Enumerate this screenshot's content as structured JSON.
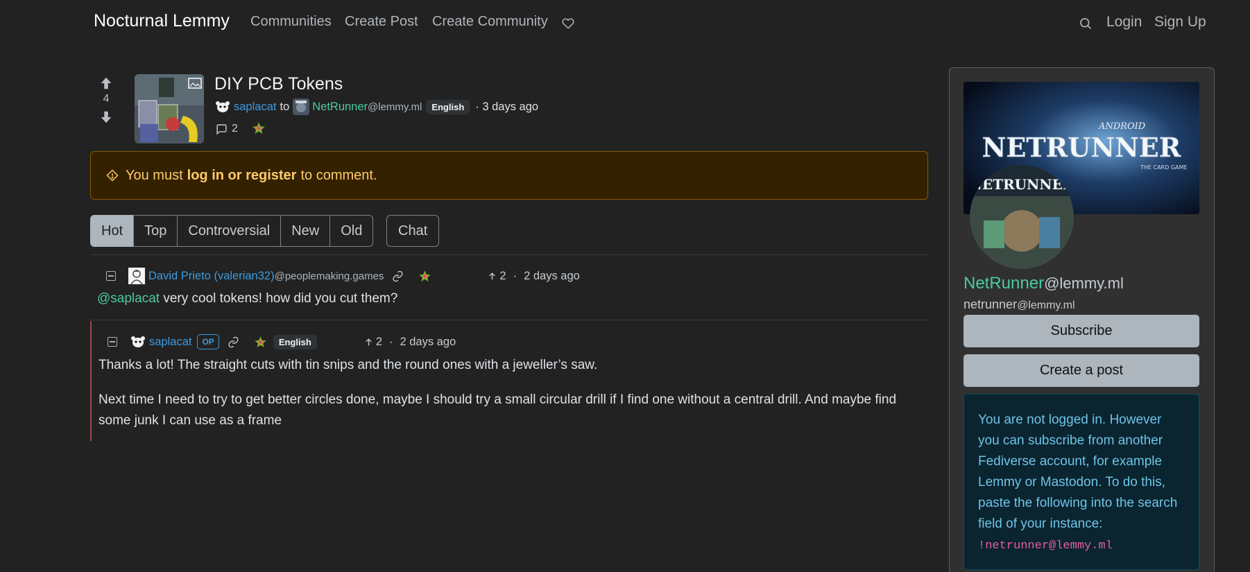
{
  "navbar": {
    "brand": "Nocturnal Lemmy",
    "links": [
      "Communities",
      "Create Post",
      "Create Community"
    ],
    "login": "Login",
    "signup": "Sign Up"
  },
  "post": {
    "title": "DIY PCB Tokens",
    "score": "4",
    "author": "saplacat",
    "to": "to",
    "community": "NetRunner",
    "community_instance": "@lemmy.ml",
    "language": "English",
    "time": "· 3 days ago",
    "comment_count": "2"
  },
  "alert": {
    "prefix": "You must",
    "link": "log in or register",
    "suffix": "to comment."
  },
  "sort": {
    "options": [
      "Hot",
      "Top",
      "Controversial",
      "New",
      "Old"
    ],
    "active": "Hot",
    "chat": "Chat"
  },
  "comments": [
    {
      "author": "David Prieto (valerian32)",
      "instance": "@peoplemaking.games",
      "score": "2",
      "time": "2 days ago",
      "mention": "@saplacat",
      "body": "very cool tokens! how did you cut them?"
    },
    {
      "author": "saplacat",
      "badge": "OP",
      "language": "English",
      "score": "2",
      "time": "2 days ago",
      "body1": "Thanks a lot! The straight cuts with tin snips and the round ones with a jeweller’s saw.",
      "body2": "Next time I need to try to get better circles done, maybe I should try a small circular drill if I find one without a central drill. And maybe find some junk I can use as a frame"
    }
  ],
  "sidebar": {
    "banner_text": "NETRUNNER",
    "banner_top": "ANDROID",
    "banner_sub": "THE CARD GAME",
    "icon_text": "NETRUNNER",
    "title": "NetRunner",
    "title_instance": "@lemmy.ml",
    "handle": "netrunner",
    "handle_instance": "@lemmy.ml",
    "subscribe": "Subscribe",
    "create_post": "Create a post",
    "info_text": "You are not logged in. However you can subscribe from another Fediverse account, for example Lemmy or Mastodon. To do this, paste the following into the search field of your instance:",
    "info_code": "!netrunner@lemmy.ml"
  },
  "colors": {
    "background": "#222222",
    "link_blue": "#3c9bde",
    "community_green": "#4cc9a2",
    "warning": "#ffca6b",
    "info": "#6fc4e6"
  },
  "icons": [
    "search-icon",
    "heart-icon",
    "upvote-icon",
    "downvote-icon",
    "comment-icon",
    "collapse-icon",
    "link-icon",
    "star-icon",
    "alert-icon",
    "arrow-up-icon"
  ]
}
